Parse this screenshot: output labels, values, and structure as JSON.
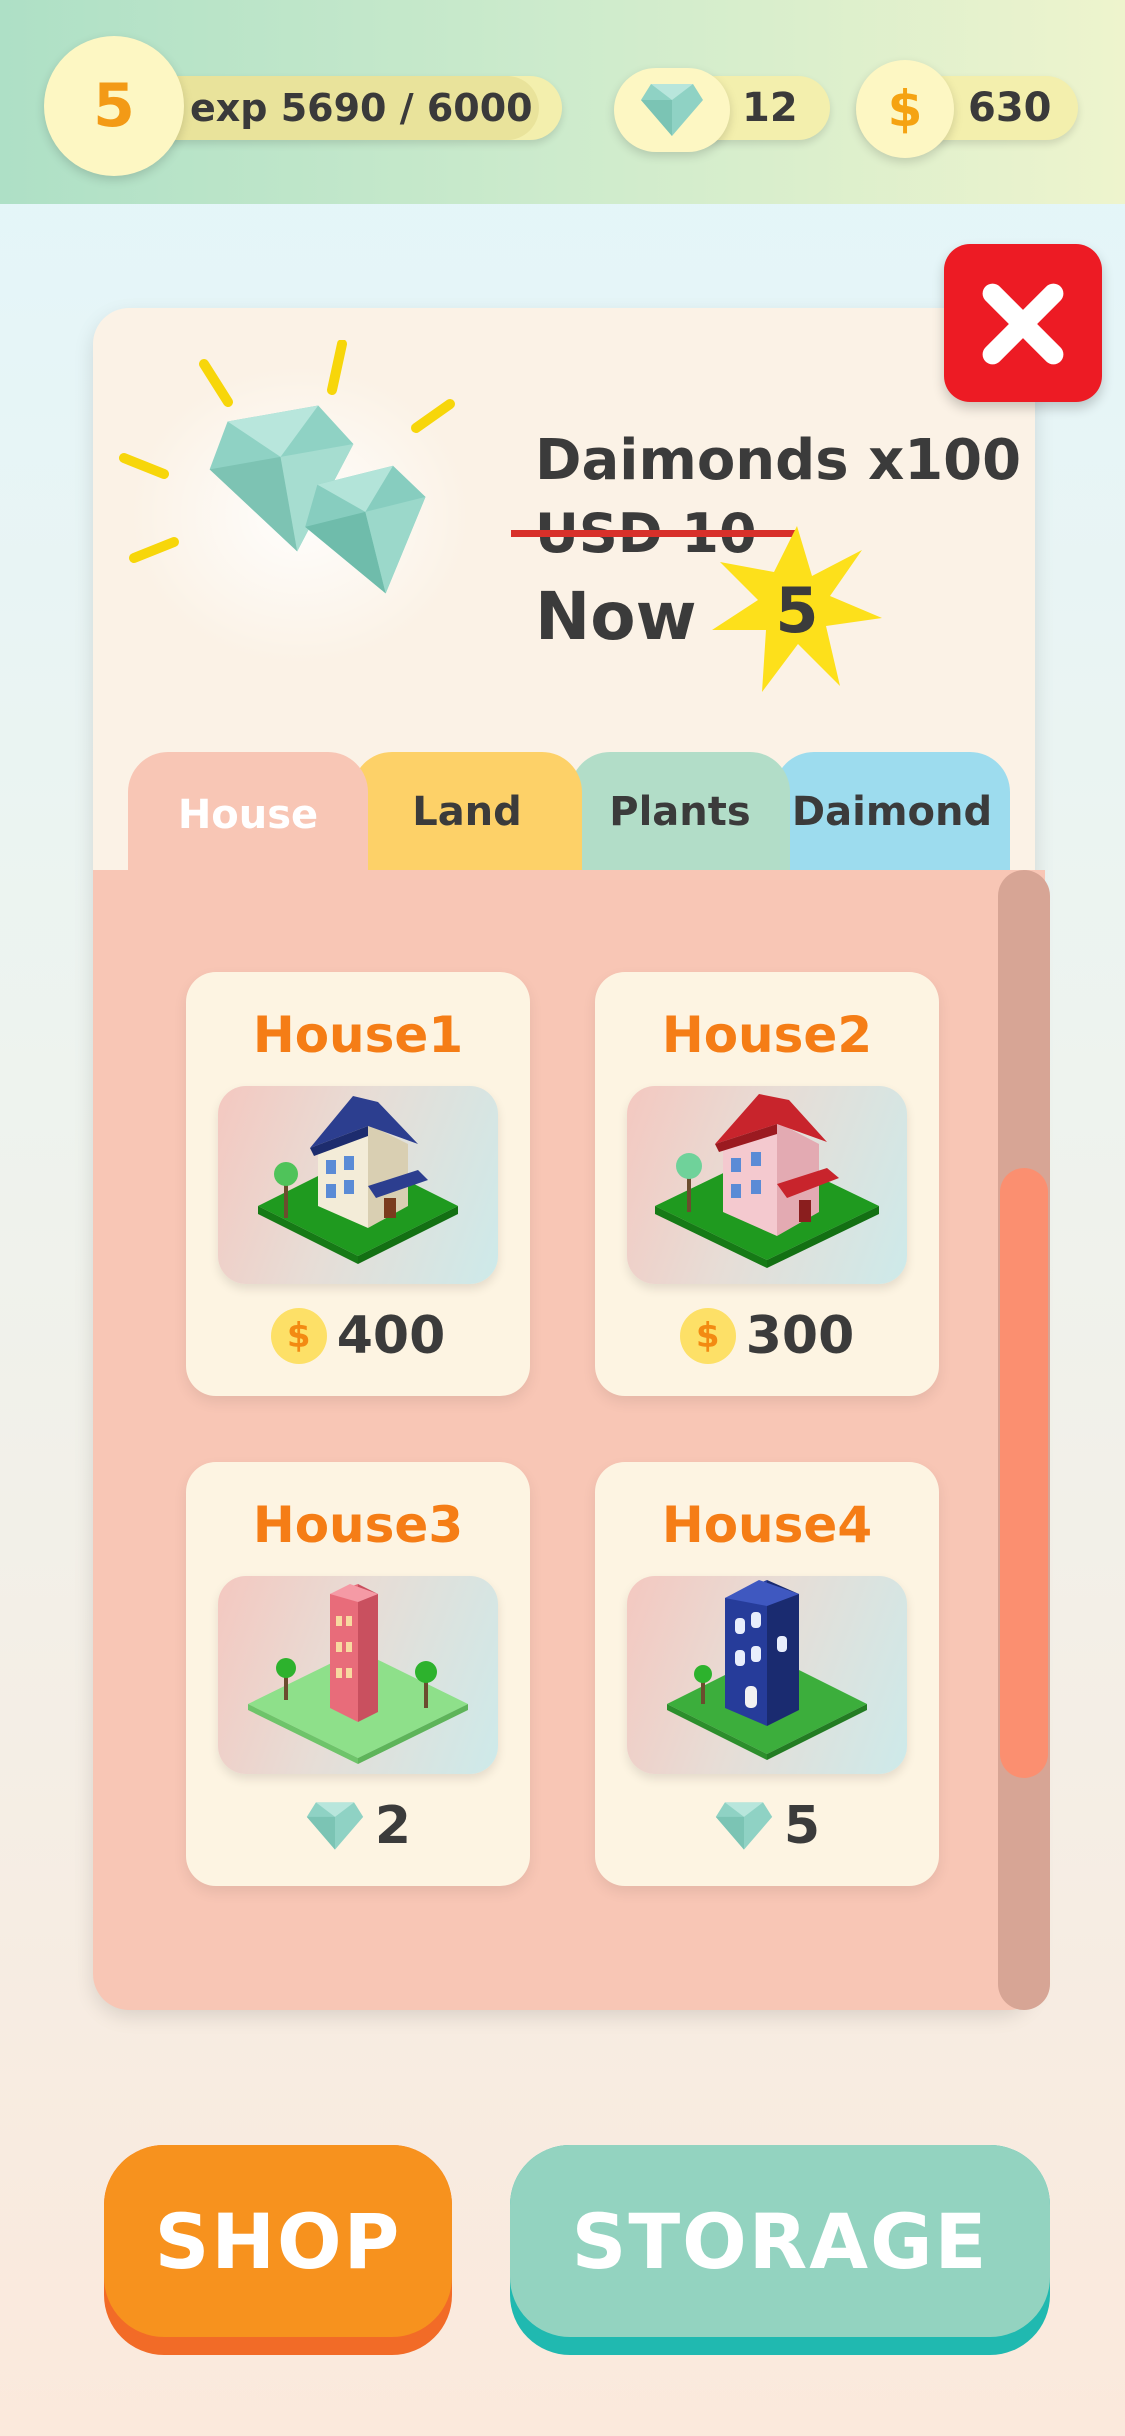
{
  "hud": {
    "level": "5",
    "exp_text": "exp 5690 / 6000",
    "exp_progress": 0.948,
    "diamonds": "12",
    "coins": "630",
    "coin_symbol": "$"
  },
  "promo": {
    "title": "Daimonds x100",
    "old_price": "USD 10",
    "now_label": "Now",
    "new_price": "5"
  },
  "tabs": [
    {
      "label": "House",
      "color": "#f8c6b5",
      "active": true
    },
    {
      "label": "Land",
      "color": "#fdd168",
      "active": false
    },
    {
      "label": "Plants",
      "color": "#b2ddc8",
      "active": false
    },
    {
      "label": "Daimond",
      "color": "#9ddcee",
      "active": false
    }
  ],
  "items": [
    {
      "name": "House1",
      "price": "400",
      "currency": "coin-icon",
      "roof": "#2c3e8f",
      "wall": "#f3ecd8"
    },
    {
      "name": "House2",
      "price": "300",
      "currency": "coin-icon",
      "roof": "#c8242c",
      "wall": "#f4c9cf"
    },
    {
      "name": "House3",
      "price": "2",
      "currency": "diamond-icon",
      "wall": "#e86c7a"
    },
    {
      "name": "House4",
      "price": "5",
      "currency": "diamond-icon",
      "wall": "#263c9a"
    }
  ],
  "buttons": {
    "shop": "SHOP",
    "storage": "STORAGE",
    "shop_color": "#f7921e",
    "storage_color": "#93d3c0"
  }
}
